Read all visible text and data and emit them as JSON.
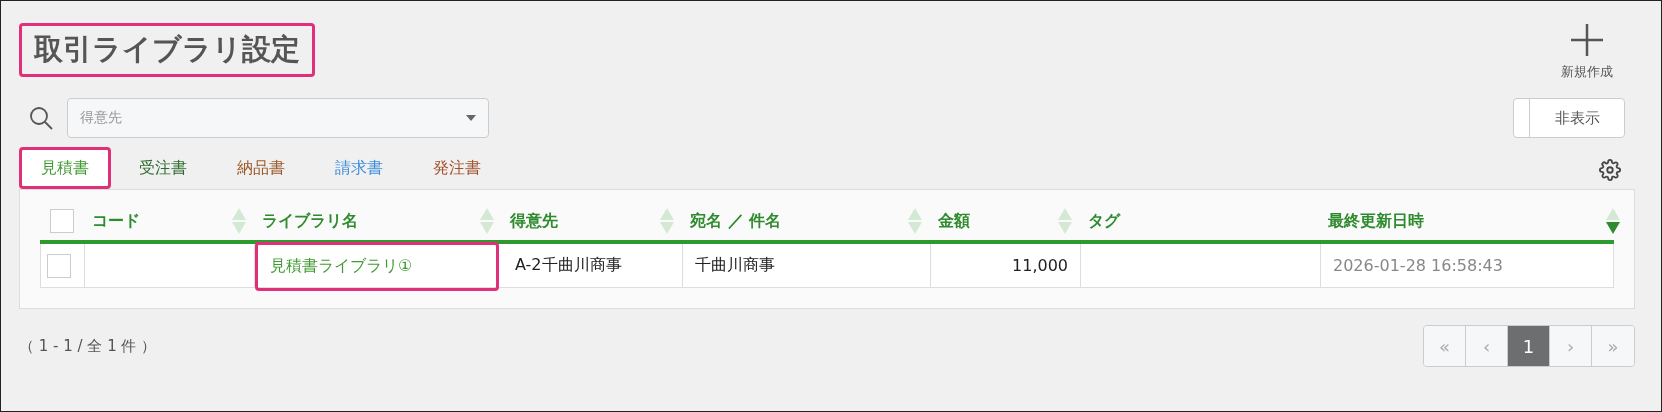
{
  "page": {
    "title": "取引ライブラリ設定",
    "title_highlighted": true
  },
  "new_button": {
    "label": "新規作成"
  },
  "customer_filter": {
    "placeholder": "得意先"
  },
  "hide_button": {
    "label": "非表示"
  },
  "tabs": [
    {
      "label": "見積書",
      "selected": true,
      "highlighted": true,
      "color": "#3f9a2f"
    },
    {
      "label": "受注書",
      "selected": false,
      "highlighted": false,
      "color": "#2e6b30"
    },
    {
      "label": "納品書",
      "selected": false,
      "highlighted": false,
      "color": "#9c5a2a"
    },
    {
      "label": "請求書",
      "selected": false,
      "highlighted": false,
      "color": "#3d8fdc"
    },
    {
      "label": "発注書",
      "selected": false,
      "highlighted": false,
      "color": "#a0522d"
    }
  ],
  "table": {
    "select_all": {
      "checked": false
    },
    "columns": [
      {
        "label": "コード",
        "sortable": true,
        "sorted_desc": false
      },
      {
        "label": "ライブラリ名",
        "sortable": true,
        "sorted_desc": false
      },
      {
        "label": "得意先",
        "sortable": true,
        "sorted_desc": false
      },
      {
        "label": "宛名 ／ 件名",
        "sortable": true,
        "sorted_desc": false
      },
      {
        "label": "金額",
        "sortable": true,
        "sorted_desc": false
      },
      {
        "label": "タグ",
        "sortable": false
      },
      {
        "label": "最終更新日時",
        "sortable": true,
        "sorted_desc": true
      }
    ],
    "rows": [
      {
        "checked": false,
        "code": "",
        "library_name": "見積書ライブラリ①",
        "name_highlighted": true,
        "customer": "A-2千曲川商事",
        "addressee": "千曲川商事",
        "amount": "11,000",
        "tag": "",
        "updated": "2026-01-28 16:58:43"
      }
    ]
  },
  "footer": {
    "count": "（ 1 - 1 / 全 1 件 ）"
  },
  "pagination": {
    "first": "«",
    "prev": "‹",
    "pages": [
      {
        "label": "1",
        "selected": true
      }
    ],
    "next": "›",
    "last": "»"
  }
}
